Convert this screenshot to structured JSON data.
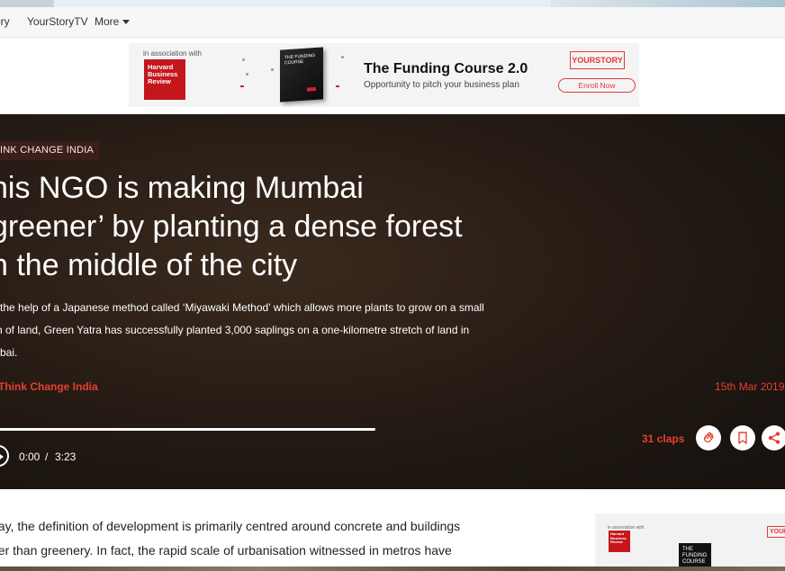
{
  "nav": {
    "items": [
      "ory",
      "YourStoryTV"
    ],
    "more_label": "More"
  },
  "banner": {
    "association": "in association with",
    "hbr_logo": "Harvard\nBusiness\nReview",
    "book_text": "THE FUNDING\nCOURSE",
    "title": "The Funding Course 2.0",
    "subtitle": "Opportunity to pitch your business plan",
    "brand": "YOURSTORY",
    "cta": "Enroll Now"
  },
  "article": {
    "category": "INK CHANGE INDIA",
    "headline": "his NGO is making Mumbai\ngreener’ by planting a dense forest\nn the middle of the city",
    "summary": "n the help of a Japanese method called ‘Miyawaki Method’ which allows more plants to grow on a small\nch of land, Green Yatra has successfully planted 3,000 saplings on a one-kilometre stretch of land in\nmbai.",
    "author": "Think Change India",
    "date": "15th Mar 2019",
    "body_preview": "day, the definition of development is primarily centred around concrete and buildings\nher than greenery. In fact, the rapid scale of urbanisation witnessed in metros have"
  },
  "audio": {
    "current_time": "0:00",
    "separator": "/",
    "total_time": "3:23",
    "progress_fraction": 0.0
  },
  "actions": {
    "claps_label": "31 claps"
  },
  "side_ad": {
    "association": "in association with",
    "hbr_logo": "Harvard\nBusiness\nReview",
    "book_text": "THE FUNDING\nCOURSE",
    "brand": "YOURS"
  },
  "colors": {
    "accent": "#e6402f",
    "category_bg": "#3a1f1a",
    "hero_bg": "#1d1611"
  }
}
